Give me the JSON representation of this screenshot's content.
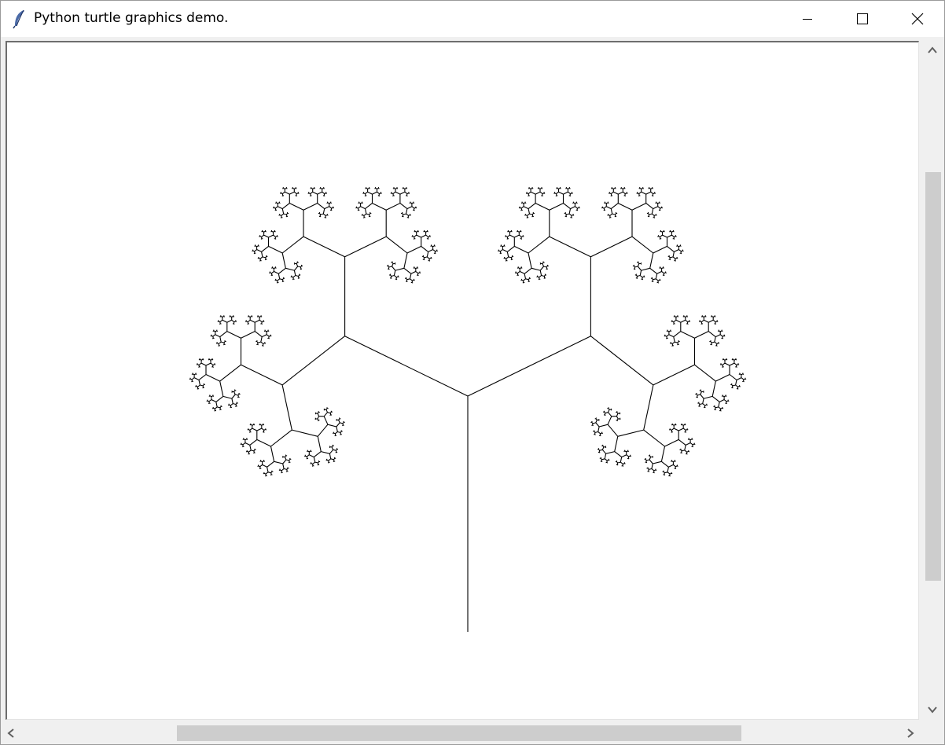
{
  "window": {
    "title": "Python turtle graphics demo.",
    "icon": "feather-icon",
    "controls": [
      "minimize-icon",
      "maximize-icon",
      "close-icon"
    ]
  },
  "canvas": {
    "background": "#ffffff",
    "stroke_color": "#000000",
    "drawing": "fractal-tree"
  },
  "scrollbars": {
    "vertical": {
      "up_icon": "chevron-up-icon",
      "down_icon": "chevron-down-icon"
    },
    "horizontal": {
      "left_icon": "chevron-left-icon",
      "right_icon": "chevron-right-icon"
    }
  }
}
